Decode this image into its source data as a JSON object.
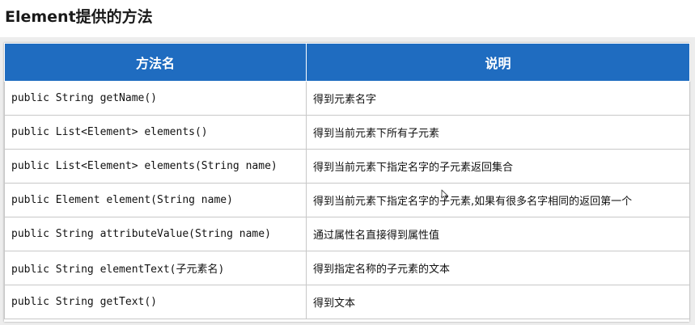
{
  "page": {
    "title": "Element提供的方法"
  },
  "table": {
    "header_color": "#1f6cc0",
    "columns": [
      "方法名",
      "说明"
    ],
    "rows": [
      {
        "method": "public String getName()",
        "description": "得到元素名字"
      },
      {
        "method": "public List<Element> elements()",
        "description": "得到当前元素下所有子元素"
      },
      {
        "method": "public List<Element> elements(String name)",
        "description": "得到当前元素下指定名字的子元素返回集合"
      },
      {
        "method": "public Element element(String name)",
        "description": "得到当前元素下指定名字的子元素,如果有很多名字相同的返回第一个"
      },
      {
        "method": "public String  attributeValue(String name)",
        "description": "通过属性名直接得到属性值"
      },
      {
        "method": "public String elementText(子元素名)",
        "description": "得到指定名称的子元素的文本"
      },
      {
        "method": "public String getText()",
        "description": "得到文本"
      }
    ]
  },
  "cursor": {
    "icon": "mouse-pointer-icon"
  }
}
